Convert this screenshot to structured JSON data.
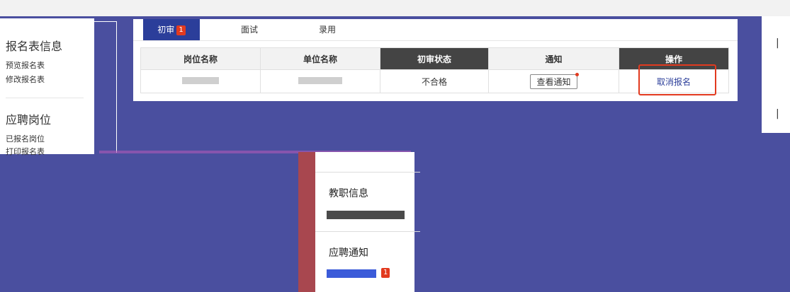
{
  "left_sidebar": {
    "section1_title": "报名表信息",
    "section1_links": [
      "预览报名表",
      "修改报名表"
    ],
    "section2_title": "应聘岗位",
    "section2_links": [
      "已报名岗位",
      "打印报名表"
    ]
  },
  "tabs": [
    {
      "label": "初审",
      "badge": "1",
      "active": true
    },
    {
      "label": "面试",
      "active": false
    },
    {
      "label": "录用",
      "active": false
    }
  ],
  "table": {
    "headers": [
      "岗位名称",
      "单位名称",
      "初审状态",
      "通知",
      "操作"
    ],
    "row": {
      "status": "不合格",
      "notice_button": "查看通知",
      "action": "取消报名"
    }
  },
  "mid_panel": {
    "row1": "教职信息",
    "row2": "应聘通知",
    "row3_badge": "1"
  },
  "colors": {
    "background": "#4a4f9f",
    "accent": "#2b3e9a",
    "alert": "#e23a1f"
  }
}
